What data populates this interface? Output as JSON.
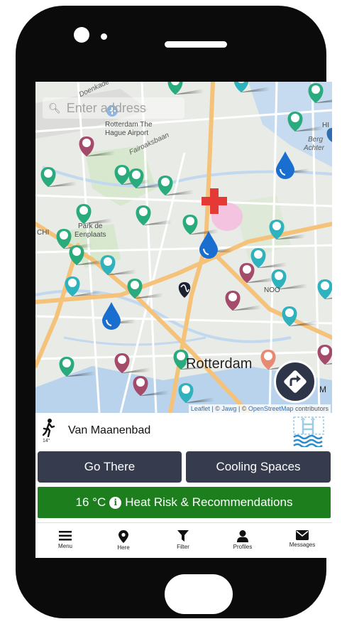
{
  "search": {
    "placeholder": "Enter address"
  },
  "map": {
    "labels": {
      "doenkade": "Doenkade",
      "airport_line1": "Rotterdam The",
      "airport_line2": "Hague Airport",
      "fairoaksbaan": "Fairoaksbaan",
      "berg_line1": "Berg",
      "berg_line2": "Achter",
      "hi": "HI",
      "park_line1": "Park de",
      "park_line2": "Eenplaats",
      "chi": "CHI",
      "noord": "NOO",
      "city": "Rotterdam",
      "m": "M"
    },
    "attribution": {
      "leaflet": "Leaflet",
      "sep1": " | © ",
      "jawg": "Jawg",
      "sep2": " | © ",
      "osm": "OpenStreetMap",
      "suffix": " contributors"
    }
  },
  "place": {
    "name": "Van Maanenbad",
    "walk_temp": "14°"
  },
  "buttons": {
    "go_there": "Go There",
    "cooling_spaces": "Cooling Spaces"
  },
  "heat": {
    "temp": "16 °C",
    "label": "Heat Risk & Recommendations"
  },
  "tabs": [
    {
      "label": "Menu",
      "icon": "menu-icon"
    },
    {
      "label": "Here",
      "icon": "location-pin-icon"
    },
    {
      "label": "Filter",
      "icon": "filter-icon"
    },
    {
      "label": "Profiles",
      "icon": "person-icon"
    },
    {
      "label": "Messages",
      "icon": "envelope-icon"
    }
  ],
  "colors": {
    "button_dark": "#363b4d",
    "heat_green": "#1d7e1e",
    "pin_green": "#2aab7e",
    "pin_teal": "#2eb2bd",
    "pin_maroon": "#a44a6b",
    "pin_salmon": "#e88a72",
    "water_blue": "#1a6ecf",
    "hospital_red": "#e53935"
  }
}
